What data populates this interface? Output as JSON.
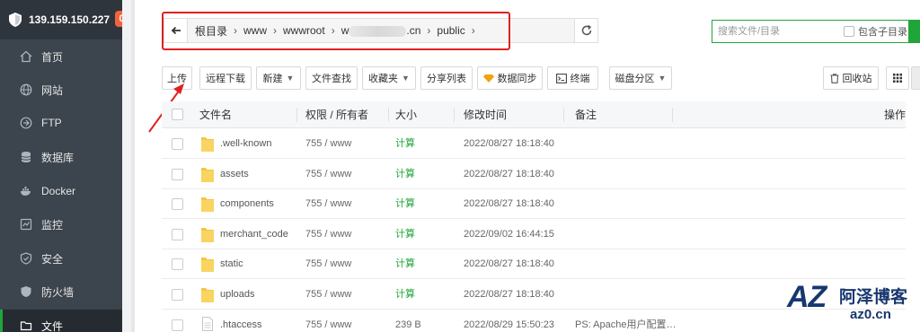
{
  "sidebar": {
    "server_ip": "139.159.150.227",
    "badge_count": "0",
    "items": [
      {
        "label": "首页",
        "icon": "home-icon"
      },
      {
        "label": "网站",
        "icon": "globe-icon"
      },
      {
        "label": "FTP",
        "icon": "ftp-icon"
      },
      {
        "label": "数据库",
        "icon": "database-icon"
      },
      {
        "label": "Docker",
        "icon": "docker-icon"
      },
      {
        "label": "监控",
        "icon": "monitor-icon"
      },
      {
        "label": "安全",
        "icon": "shield-icon"
      },
      {
        "label": "防火墙",
        "icon": "firewall-icon"
      },
      {
        "label": "文件",
        "icon": "folder-icon"
      }
    ]
  },
  "pathbar": {
    "crumbs": [
      "根目录",
      "www",
      "wwwroot",
      "w",
      ".cn",
      "public"
    ]
  },
  "search": {
    "placeholder": "搜索文件/目录",
    "subdir_label": "包含子目录"
  },
  "toolbar": {
    "upload": "上传",
    "remote_download": "远程下载",
    "new": "新建",
    "file_search": "文件查找",
    "favorites": "收藏夹",
    "share_list": "分享列表",
    "data_sync": "数据同步",
    "terminal": "终端",
    "disk_partition": "磁盘分区",
    "recycle_bin": "回收站"
  },
  "table": {
    "headers": {
      "name": "文件名",
      "perm": "权限 / 所有者",
      "size": "大小",
      "mtime": "修改时间",
      "note": "备注",
      "ops": "操作"
    },
    "rows": [
      {
        "name": ".well-known",
        "perm": "755 / www",
        "size": "计算",
        "mtime": "2022/08/27 18:18:40",
        "note": "",
        "type": "folder"
      },
      {
        "name": "assets",
        "perm": "755 / www",
        "size": "计算",
        "mtime": "2022/08/27 18:18:40",
        "note": "",
        "type": "folder"
      },
      {
        "name": "components",
        "perm": "755 / www",
        "size": "计算",
        "mtime": "2022/08/27 18:18:40",
        "note": "",
        "type": "folder"
      },
      {
        "name": "merchant_code",
        "perm": "755 / www",
        "size": "计算",
        "mtime": "2022/09/02 16:44:15",
        "note": "",
        "type": "folder"
      },
      {
        "name": "static",
        "perm": "755 / www",
        "size": "计算",
        "mtime": "2022/08/27 18:18:40",
        "note": "",
        "type": "folder"
      },
      {
        "name": "uploads",
        "perm": "755 / www",
        "size": "计算",
        "mtime": "2022/08/27 18:18:40",
        "note": "",
        "type": "folder"
      },
      {
        "name": ".htaccess",
        "perm": "755 / www",
        "size": "239 B",
        "mtime": "2022/08/29 15:50:23",
        "note": "PS: Apache用户配置…",
        "type": "file"
      }
    ]
  },
  "watermark": {
    "logo": "AZ",
    "name": "阿泽博客",
    "url": "az0.cn"
  },
  "colors": {
    "accent": "#20a53a",
    "sidebar": "#3c444d",
    "highlight": "#e02020",
    "badge": "#f0643c"
  }
}
